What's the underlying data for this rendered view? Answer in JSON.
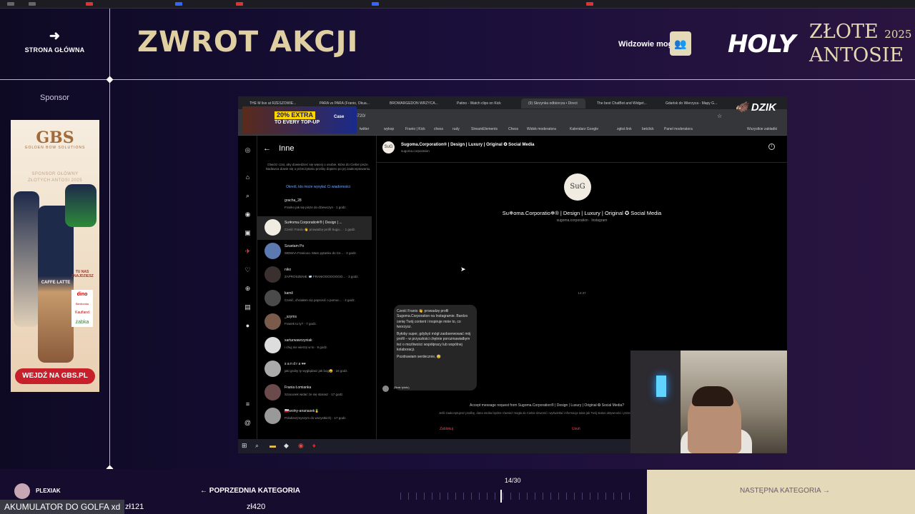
{
  "header": {
    "home_label": "STRONA GŁÓWNA",
    "page_title": "ZWROT AKCJI",
    "viewers_label": "Widzowie mogą",
    "logo_holy": "HOLY",
    "logo_zlote": "ZŁOTE",
    "logo_year": "2025",
    "logo_antosie": "ANTOSIE"
  },
  "sponsor": {
    "label": "Sponsor",
    "brand": "GBS",
    "brand_sub": "GOLDEN BOW SOLUTIONS",
    "tagline_1": "SPONSOR GŁÓWNY",
    "tagline_2": "ZŁOTYCH ANTOSI 2025",
    "shops": [
      "dino",
      "Biedronka",
      "Kaufland",
      "żabka"
    ],
    "cta": "WEJDŹ NA GBS.PL",
    "can_label": "CAFFE LATTE",
    "badge": "TU NAS ZNAJDZIESZ"
  },
  "browser": {
    "tabs": [
      "THE M live at RZESZOWIE...",
      "PARA vs PARA (Franio, Okua...",
      "BROWARGEDON WRZYCA...",
      "Patino - Watch clips on Kick",
      "(9) Skrzynka odbiorcza • Direct",
      "The best ChatBot and Widget...",
      "Gdańsk do Wierzyca - Mapy G..."
    ],
    "url_fragment": "06720/",
    "banner_extra": "20% EXTRA",
    "banner_every": "TO EVERY TOP-UP",
    "banner_brand": "Case",
    "dzik_logo": "DZIK",
    "bookmarks": [
      "twitter",
      "wykop",
      "Franio | Kick",
      "chess",
      "rudy",
      "StreamElements",
      "Chess",
      "Widok moderatora",
      "Kalendarz Google",
      "zgłoś link",
      "betclick",
      "Panel moderatora",
      "Wszystkie zakładki"
    ]
  },
  "instagram": {
    "list_title": "Inne",
    "info_text": "Otwórz czat, aby dowiedzieć się więcej o osobie, która do Ciebie pisze. Nadawca dowie się o przeczytaniu prośby dopiero po jej zaakceptowaniu.",
    "info_link": "Określ, kto może wysyłać Ci wiadomości",
    "conversations": [
      {
        "name": "gracha_28",
        "preview": "Franko jak się pisze do dziewczyn · 1 godz."
      },
      {
        "name": "Su❄oma.Corporatio❄® | Design | ...",
        "preview": "Cześć Franio 👋 prowadzę profil Sugo... · 1 godz."
      },
      {
        "name": "Szuetam Po",
        "preview": "SIEMAA Franiooo. Mam pytanko do Ce... · 2 godz."
      },
      {
        "name": "niko",
        "preview": "ZAPROSZENIE 📨 FRANIOOOOOOOO... · 3 godz."
      },
      {
        "name": "kamil",
        "preview": "Cześć, chciałem cię poprosić o pomoc... · 4 godz."
      },
      {
        "name": "_szyms",
        "preview": "Franek to ty? · 7 godz."
      },
      {
        "name": "xarturwawrzyniak",
        "preview": "i chuj nie wierzę w to · 9 godz."
      },
      {
        "name": "s a n d r a 🕶",
        "preview": "jaki gruby ty wyglądasz jak bog😮 · 16 godz."
      },
      {
        "name": "Frania Łomianka",
        "preview": "Szacunek widać że się starasz · 17 godz."
      },
      {
        "name": "🇵🇱wolny-ananasek🍍",
        "preview": "Polubisz(myszym do wszystkich) · 17 godz."
      }
    ],
    "chat": {
      "name": "Sugoma.Corporation® | Design | Luxury | Original ✪ Social Media",
      "handle": "sugoma.corporation",
      "profile_name": "Su❄oma.Corporatio❄® | Design | Luxury | Original ✪ Social Media",
      "profile_sub": "sugoma.corporation · Instagram",
      "avatar_text": "SuG",
      "time": "14:47",
      "message": [
        "Cześć Franio 👋 prowadzę profil Sugoma.Corporation na Instagramie. Bardzo cenię Twój content i inspiruje mnie to, co tworzysz.",
        "Byłoby super, gdybyś mógł zaobserwować mój profil – w przyszłości chętnie porozmawiałbym też o możliwości współpracy lub wspólnej kolaboracji.",
        "Pozdrawiam serdecznie, 😊"
      ],
      "attachment": "(Brak tytułu)",
      "accept_text": "Accept message request from Sugoma.Corporation® | Design | Luxury | Original ✪ Social Media?",
      "accept_sub": "Jeśli zaakceptujesz prośbę, dana osoba będzie również mogła do Ciebie dzwonić i wyświetlać informacje takie jak Twój status aktywności i przeczytanie przez Ciebie wiadomości.",
      "block_label": "Zablokuj",
      "delete_label": "Usuń"
    }
  },
  "footer": {
    "prev_label": "POPRZEDNIA KATEGORIA",
    "next_label": "NASTĘPNA KATEGORIA",
    "progress_text": "14/30",
    "progress_fraction": 0.467,
    "user_name": "PLEXIAK",
    "donation_text": "AKUMULATOR DO GOLFA xd",
    "donation_1": "zł121",
    "donation_2": "zł420"
  },
  "colors": {
    "gold": "#e0cfa0",
    "cream_button": "#e4d9b8",
    "background": "#1a0f3a",
    "instagram_link": "#6fa8ff",
    "danger": "#ed4956"
  }
}
